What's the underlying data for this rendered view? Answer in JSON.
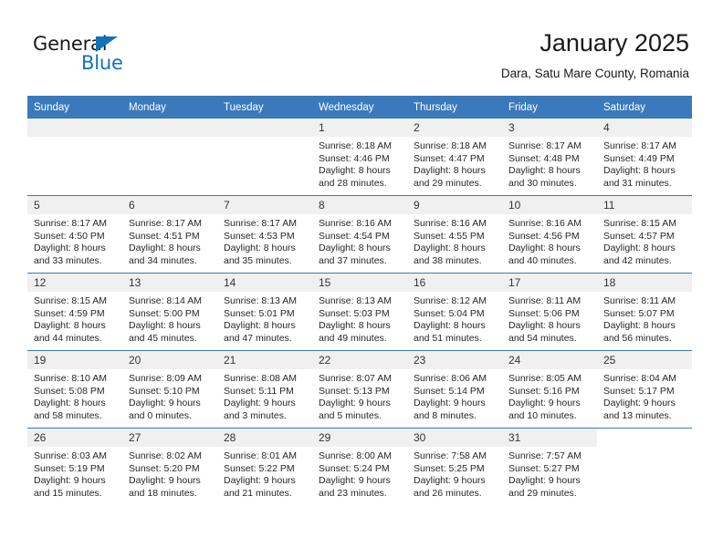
{
  "brand": {
    "name_top": "General",
    "name_bottom": "Blue",
    "accent_color": "#1272ba"
  },
  "header": {
    "title": "January 2025",
    "subtitle": "Dara, Satu Mare County, Romania"
  },
  "calendar": {
    "header_bg": "#3b79bd",
    "daynum_bg": "#f0f0f0",
    "columns": [
      "Sunday",
      "Monday",
      "Tuesday",
      "Wednesday",
      "Thursday",
      "Friday",
      "Saturday"
    ],
    "weeks": [
      [
        {
          "day": "",
          "empty": true,
          "placeholder": true
        },
        {
          "day": "",
          "empty": true,
          "placeholder": true
        },
        {
          "day": "",
          "empty": true,
          "placeholder": true
        },
        {
          "day": "1",
          "sunrise": "Sunrise: 8:18 AM",
          "sunset": "Sunset: 4:46 PM",
          "daylight1": "Daylight: 8 hours",
          "daylight2": "and 28 minutes."
        },
        {
          "day": "2",
          "sunrise": "Sunrise: 8:18 AM",
          "sunset": "Sunset: 4:47 PM",
          "daylight1": "Daylight: 8 hours",
          "daylight2": "and 29 minutes."
        },
        {
          "day": "3",
          "sunrise": "Sunrise: 8:17 AM",
          "sunset": "Sunset: 4:48 PM",
          "daylight1": "Daylight: 8 hours",
          "daylight2": "and 30 minutes."
        },
        {
          "day": "4",
          "sunrise": "Sunrise: 8:17 AM",
          "sunset": "Sunset: 4:49 PM",
          "daylight1": "Daylight: 8 hours",
          "daylight2": "and 31 minutes."
        }
      ],
      [
        {
          "day": "5",
          "sunrise": "Sunrise: 8:17 AM",
          "sunset": "Sunset: 4:50 PM",
          "daylight1": "Daylight: 8 hours",
          "daylight2": "and 33 minutes."
        },
        {
          "day": "6",
          "sunrise": "Sunrise: 8:17 AM",
          "sunset": "Sunset: 4:51 PM",
          "daylight1": "Daylight: 8 hours",
          "daylight2": "and 34 minutes."
        },
        {
          "day": "7",
          "sunrise": "Sunrise: 8:17 AM",
          "sunset": "Sunset: 4:53 PM",
          "daylight1": "Daylight: 8 hours",
          "daylight2": "and 35 minutes."
        },
        {
          "day": "8",
          "sunrise": "Sunrise: 8:16 AM",
          "sunset": "Sunset: 4:54 PM",
          "daylight1": "Daylight: 8 hours",
          "daylight2": "and 37 minutes."
        },
        {
          "day": "9",
          "sunrise": "Sunrise: 8:16 AM",
          "sunset": "Sunset: 4:55 PM",
          "daylight1": "Daylight: 8 hours",
          "daylight2": "and 38 minutes."
        },
        {
          "day": "10",
          "sunrise": "Sunrise: 8:16 AM",
          "sunset": "Sunset: 4:56 PM",
          "daylight1": "Daylight: 8 hours",
          "daylight2": "and 40 minutes."
        },
        {
          "day": "11",
          "sunrise": "Sunrise: 8:15 AM",
          "sunset": "Sunset: 4:57 PM",
          "daylight1": "Daylight: 8 hours",
          "daylight2": "and 42 minutes."
        }
      ],
      [
        {
          "day": "12",
          "sunrise": "Sunrise: 8:15 AM",
          "sunset": "Sunset: 4:59 PM",
          "daylight1": "Daylight: 8 hours",
          "daylight2": "and 44 minutes."
        },
        {
          "day": "13",
          "sunrise": "Sunrise: 8:14 AM",
          "sunset": "Sunset: 5:00 PM",
          "daylight1": "Daylight: 8 hours",
          "daylight2": "and 45 minutes."
        },
        {
          "day": "14",
          "sunrise": "Sunrise: 8:13 AM",
          "sunset": "Sunset: 5:01 PM",
          "daylight1": "Daylight: 8 hours",
          "daylight2": "and 47 minutes."
        },
        {
          "day": "15",
          "sunrise": "Sunrise: 8:13 AM",
          "sunset": "Sunset: 5:03 PM",
          "daylight1": "Daylight: 8 hours",
          "daylight2": "and 49 minutes."
        },
        {
          "day": "16",
          "sunrise": "Sunrise: 8:12 AM",
          "sunset": "Sunset: 5:04 PM",
          "daylight1": "Daylight: 8 hours",
          "daylight2": "and 51 minutes."
        },
        {
          "day": "17",
          "sunrise": "Sunrise: 8:11 AM",
          "sunset": "Sunset: 5:06 PM",
          "daylight1": "Daylight: 8 hours",
          "daylight2": "and 54 minutes."
        },
        {
          "day": "18",
          "sunrise": "Sunrise: 8:11 AM",
          "sunset": "Sunset: 5:07 PM",
          "daylight1": "Daylight: 8 hours",
          "daylight2": "and 56 minutes."
        }
      ],
      [
        {
          "day": "19",
          "sunrise": "Sunrise: 8:10 AM",
          "sunset": "Sunset: 5:08 PM",
          "daylight1": "Daylight: 8 hours",
          "daylight2": "and 58 minutes."
        },
        {
          "day": "20",
          "sunrise": "Sunrise: 8:09 AM",
          "sunset": "Sunset: 5:10 PM",
          "daylight1": "Daylight: 9 hours",
          "daylight2": "and 0 minutes."
        },
        {
          "day": "21",
          "sunrise": "Sunrise: 8:08 AM",
          "sunset": "Sunset: 5:11 PM",
          "daylight1": "Daylight: 9 hours",
          "daylight2": "and 3 minutes."
        },
        {
          "day": "22",
          "sunrise": "Sunrise: 8:07 AM",
          "sunset": "Sunset: 5:13 PM",
          "daylight1": "Daylight: 9 hours",
          "daylight2": "and 5 minutes."
        },
        {
          "day": "23",
          "sunrise": "Sunrise: 8:06 AM",
          "sunset": "Sunset: 5:14 PM",
          "daylight1": "Daylight: 9 hours",
          "daylight2": "and 8 minutes."
        },
        {
          "day": "24",
          "sunrise": "Sunrise: 8:05 AM",
          "sunset": "Sunset: 5:16 PM",
          "daylight1": "Daylight: 9 hours",
          "daylight2": "and 10 minutes."
        },
        {
          "day": "25",
          "sunrise": "Sunrise: 8:04 AM",
          "sunset": "Sunset: 5:17 PM",
          "daylight1": "Daylight: 9 hours",
          "daylight2": "and 13 minutes."
        }
      ],
      [
        {
          "day": "26",
          "sunrise": "Sunrise: 8:03 AM",
          "sunset": "Sunset: 5:19 PM",
          "daylight1": "Daylight: 9 hours",
          "daylight2": "and 15 minutes."
        },
        {
          "day": "27",
          "sunrise": "Sunrise: 8:02 AM",
          "sunset": "Sunset: 5:20 PM",
          "daylight1": "Daylight: 9 hours",
          "daylight2": "and 18 minutes."
        },
        {
          "day": "28",
          "sunrise": "Sunrise: 8:01 AM",
          "sunset": "Sunset: 5:22 PM",
          "daylight1": "Daylight: 9 hours",
          "daylight2": "and 21 minutes."
        },
        {
          "day": "29",
          "sunrise": "Sunrise: 8:00 AM",
          "sunset": "Sunset: 5:24 PM",
          "daylight1": "Daylight: 9 hours",
          "daylight2": "and 23 minutes."
        },
        {
          "day": "30",
          "sunrise": "Sunrise: 7:58 AM",
          "sunset": "Sunset: 5:25 PM",
          "daylight1": "Daylight: 9 hours",
          "daylight2": "and 26 minutes."
        },
        {
          "day": "31",
          "sunrise": "Sunrise: 7:57 AM",
          "sunset": "Sunset: 5:27 PM",
          "daylight1": "Daylight: 9 hours",
          "daylight2": "and 29 minutes."
        },
        {
          "day": "",
          "empty": true,
          "placeholder": false
        }
      ]
    ]
  }
}
